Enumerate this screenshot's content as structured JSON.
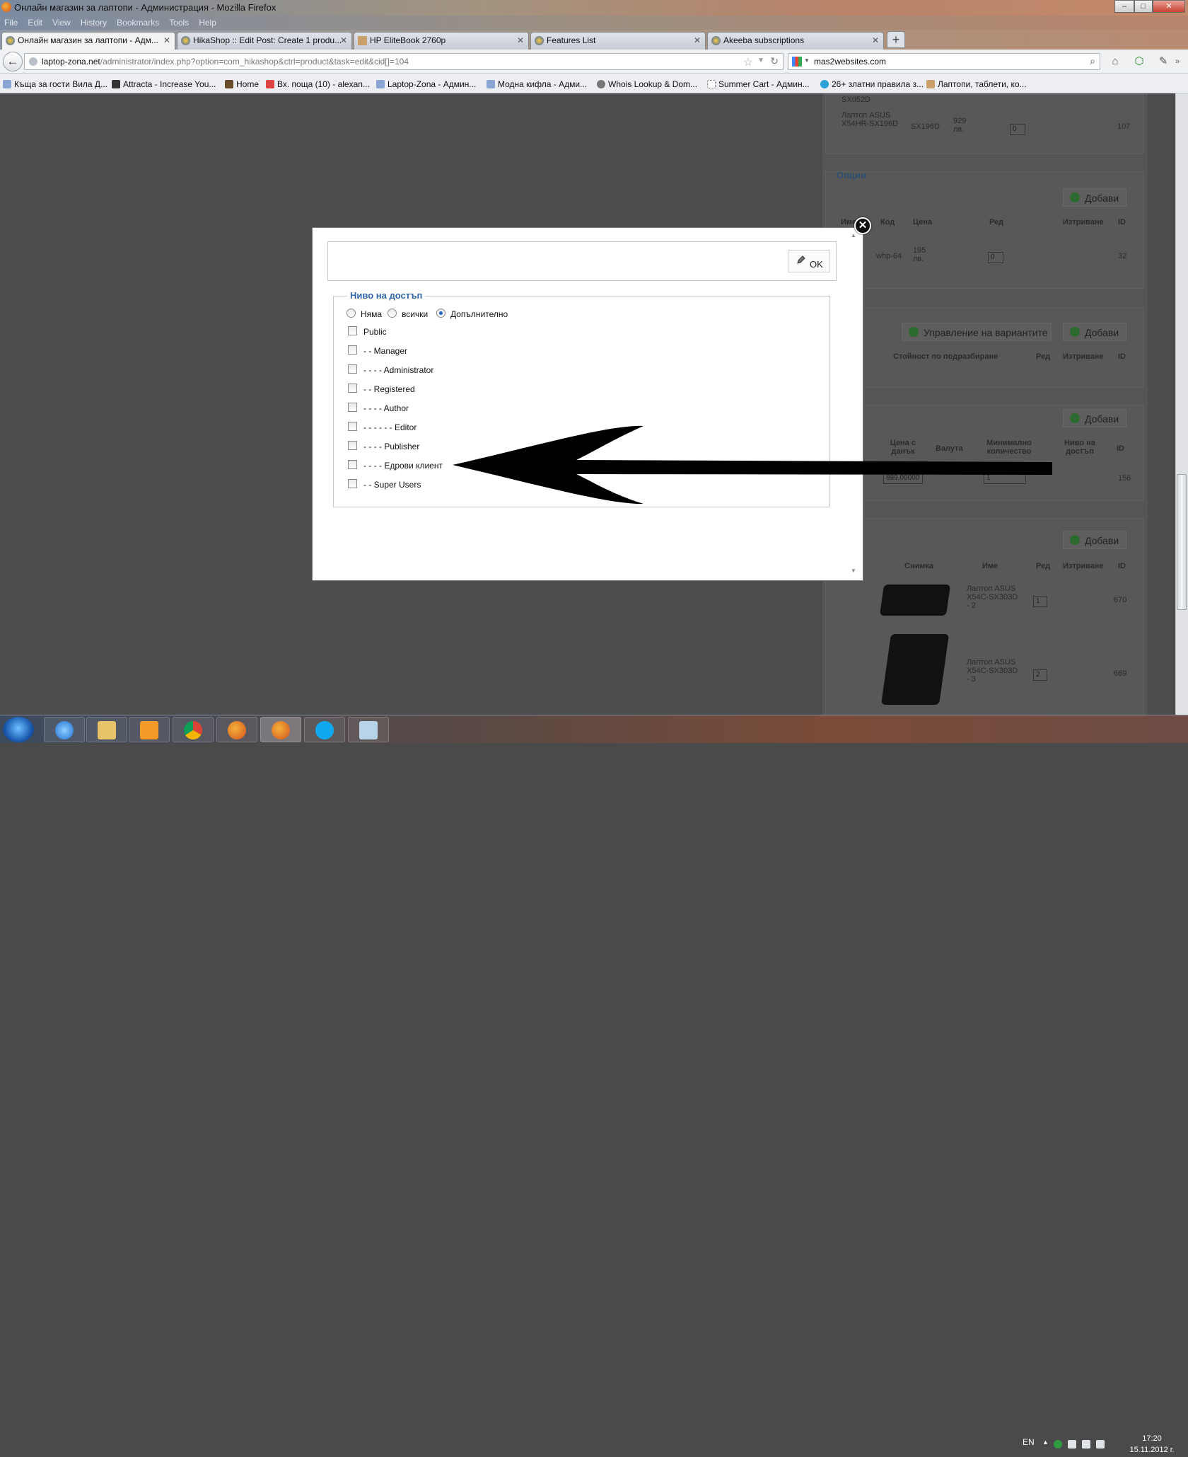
{
  "window": {
    "title": "Онлайн магазин за лаптопи - Администрация - Mozilla Firefox",
    "buttons": {
      "minimize": "–",
      "maximize": "□",
      "close": "✕"
    }
  },
  "menu": [
    "File",
    "Edit",
    "View",
    "History",
    "Bookmarks",
    "Tools",
    "Help"
  ],
  "tabs": [
    {
      "label": "Онлайн магазин за лаптопи - Адм...",
      "active": true
    },
    {
      "label": "HikaShop :: Edit Post: Create 1 produ..."
    },
    {
      "label": "HP EliteBook 2760p"
    },
    {
      "label": "Features List"
    },
    {
      "label": "Akeeba subscriptions"
    }
  ],
  "nav": {
    "url_domain": "laptop-zona.net",
    "url_path": "/administrator/index.php?option=com_hikashop&ctrl=product&task=edit&cid[]=104",
    "search_value": "mas2websites.com"
  },
  "bookmarks": [
    "Къща за гости Вила Д...",
    "Attracta - Increase You...",
    "Home",
    "Вх. поща (10) - alexan...",
    "Laptop-Zona - Админ...",
    "Модна кифла - Адми...",
    "Whois Lookup & Dom...",
    "Summer Cart - Админ...",
    "26+ златни правила з...",
    "Лаптопи, таблети, ко..."
  ],
  "background": {
    "top_product": {
      "name_prev": "SX052D",
      "name": "Лаптоп ASUS X54HR-SX196D",
      "code": "SX196D",
      "price": "929 лв.",
      "order": "0",
      "id": "107"
    },
    "options": {
      "legend": "Опции",
      "add_label": "Добави",
      "headers": [
        "Име",
        "Код",
        "Цена",
        "Ред",
        "Изтриване",
        "ID"
      ],
      "row": {
        "code": "whp-64",
        "price": "195 лв.",
        "order": "0",
        "id": "32"
      }
    },
    "variants": {
      "manage_label": "Управление на вариантите",
      "add_label": "Добави",
      "headers": [
        "Стойност по подразбиране",
        "Ред",
        "Изтриване",
        "ID"
      ]
    },
    "prices": {
      "add_label": "Добави",
      "headers": [
        "Цена с данък",
        "Валута",
        "Минимално количество",
        "Ниво на достъп",
        "ID"
      ],
      "row": {
        "price": "899.00000",
        "qty": "1",
        "id": "156"
      }
    },
    "images": {
      "add_label": "Добави",
      "headers": [
        "Снимка",
        "Име",
        "Ред",
        "Изтриване",
        "ID"
      ],
      "rows": [
        {
          "name": "Лаптоп ASUS X54C-SX303D - 2",
          "order": "1",
          "id": "670"
        },
        {
          "name": "Лаптоп ASUS X54C-SX303D - 3",
          "order": "2",
          "id": "669"
        }
      ]
    }
  },
  "modal": {
    "ok_label": "OK",
    "legend": "Ниво на достъп",
    "radios": [
      {
        "label": "Няма",
        "checked": false
      },
      {
        "label": "всички",
        "checked": false
      },
      {
        "label": "Допълнително",
        "checked": true
      }
    ],
    "groups": [
      "Public",
      "- - Manager",
      "- - - - Administrator",
      "- - Registered",
      "- - - - Author",
      "- - - - - - Editor",
      "- - - - Publisher",
      "- - - - Едрови клиент",
      "- - Super Users"
    ]
  },
  "taskbar": {
    "lang": "EN",
    "time": "17:20",
    "date": "15.11.2012 г."
  }
}
